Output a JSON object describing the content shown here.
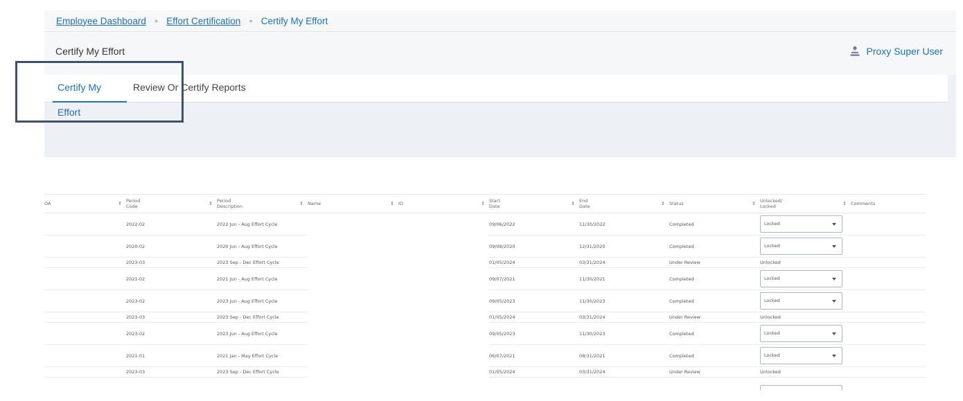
{
  "breadcrumb": {
    "items": [
      "Employee Dashboard",
      "Effort Certification"
    ],
    "current": "Certify My Effort",
    "separator": "●"
  },
  "header": {
    "title": "Certify My Effort",
    "proxy_label": "Proxy Super User",
    "proxy_icon": "users-icon"
  },
  "tabs": [
    {
      "label": "Certify My Effort",
      "active": true
    },
    {
      "label": "Review Or Certify Reports",
      "active": false
    }
  ],
  "table": {
    "sort_icon": "⇕",
    "columns": [
      {
        "line1": "OA",
        "line2": ""
      },
      {
        "line1": "Period",
        "line2": "Code"
      },
      {
        "line1": "Period",
        "line2": "Description"
      },
      {
        "line1": "Name",
        "line2": ""
      },
      {
        "line1": "ID",
        "line2": ""
      },
      {
        "line1": "Start",
        "line2": "Date"
      },
      {
        "line1": "End",
        "line2": "Date"
      },
      {
        "line1": "Status",
        "line2": ""
      },
      {
        "line1": "Unlocked/",
        "line2": "Locked"
      },
      {
        "line1": "Comments",
        "line2": ""
      }
    ],
    "rows": [
      {
        "code": "2022-02",
        "desc": "2022 Jun - Aug Effort Cycle",
        "start": "09/06/2022",
        "end": "11/30/2022",
        "status": "Completed",
        "lock": "Locked",
        "is_select": true
      },
      {
        "code": "2020-02",
        "desc": "2020 Jun - Aug Effort Cycle",
        "start": "09/08/2020",
        "end": "12/31/2020",
        "status": "Completed",
        "lock": "Locked",
        "is_select": true
      },
      {
        "code": "2023-03",
        "desc": "2023 Sep - Dec Effort Cycle",
        "start": "01/05/2024",
        "end": "03/31/2024",
        "status": "Under Review",
        "lock": "Unlocked",
        "is_select": false
      },
      {
        "code": "2021-02",
        "desc": "2021 Jun - Aug Effort Cycle",
        "start": "09/07/2021",
        "end": "11/30/2021",
        "status": "Completed",
        "lock": "Locked",
        "is_select": true
      },
      {
        "code": "2023-02",
        "desc": "2023 Jun - Aug Effort Cycle",
        "start": "09/05/2023",
        "end": "11/30/2023",
        "status": "Completed",
        "lock": "Locked",
        "is_select": true
      },
      {
        "code": "2023-03",
        "desc": "2023 Sep - Dec Effort Cycle",
        "start": "01/05/2024",
        "end": "03/31/2024",
        "status": "Under Review",
        "lock": "Unlocked",
        "is_select": false
      },
      {
        "code": "2023-02",
        "desc": "2023 Jun - Aug Effort Cycle",
        "start": "09/05/2023",
        "end": "11/30/2023",
        "status": "Completed",
        "lock": "Locked",
        "is_select": true
      },
      {
        "code": "2021-01",
        "desc": "2021 Jan - May Effort Cycle",
        "start": "06/07/2021",
        "end": "08/31/2021",
        "status": "Completed",
        "lock": "Locked",
        "is_select": true
      },
      {
        "code": "2023-03",
        "desc": "2023 Sep - Dec Effort Cycle",
        "start": "01/05/2024",
        "end": "03/31/2024",
        "status": "Under Review",
        "lock": "Unlocked",
        "is_select": false
      }
    ]
  }
}
